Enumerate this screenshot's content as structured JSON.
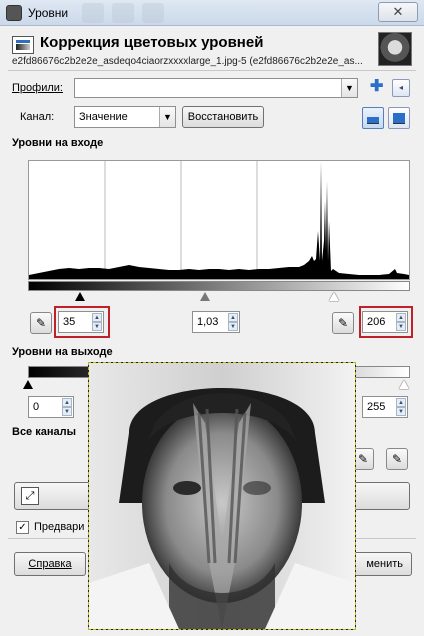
{
  "window": {
    "title": "Уровни",
    "close_glyph": "✕"
  },
  "header": {
    "title": "Коррекция цветовых уровней",
    "subtitle": "e2fd86676c2b2e2e_asdeqo4ciaorzxxxxlarge_1.jpg-5 (e2fd86676c2b2e2e_as..."
  },
  "profiles": {
    "label": "Профили:",
    "value": ""
  },
  "channel": {
    "label": "Канал:",
    "value": "Значение",
    "reset_label": "Восстановить"
  },
  "input_levels": {
    "section_title": "Уровни на входе",
    "low": "35",
    "gamma": "1,03",
    "high": "206"
  },
  "output_levels": {
    "section_title": "Уровни на выходе",
    "low": "0",
    "high": "255"
  },
  "all_channels": {
    "section_title": "Все каналы"
  },
  "preview": {
    "label": "Предвари",
    "checked": true
  },
  "buttons": {
    "help": "Справка",
    "apply": "менить"
  },
  "icons": {
    "plus": "plus-icon",
    "menu": "menu-icon",
    "linear": "linear-histogram-icon",
    "log": "log-histogram-icon",
    "eyedropper": "eyedropper-icon"
  },
  "colors": {
    "highlight": "#c0202a",
    "dashed_border": "#b8b818"
  }
}
